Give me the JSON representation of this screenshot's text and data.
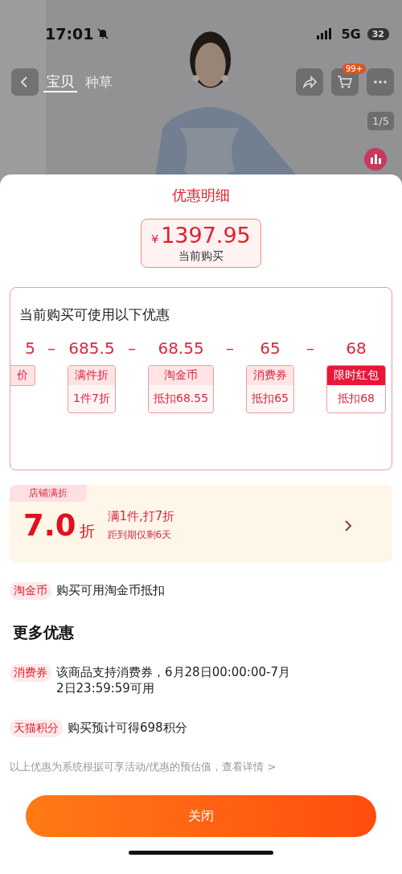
{
  "status_bar": {
    "time": "17:01",
    "network": "5G",
    "battery": "32"
  },
  "nav": {
    "tabs": [
      {
        "label": "宝贝",
        "selected": true
      },
      {
        "label": "种草",
        "selected": false
      }
    ],
    "cart_badge": "99+",
    "page_indicator": "1/5"
  },
  "sheet": {
    "title": "优惠明细",
    "price": {
      "currency": "¥",
      "amount": "1397.95",
      "label": "当前购买"
    },
    "breakdown": {
      "heading": "当前购买可使用以下优惠",
      "items": [
        {
          "amount": "5",
          "tag": "价",
          "kind": "normal"
        },
        {
          "operator": "–",
          "amount": "685.5",
          "tag": "满件折",
          "detail": "1件7折",
          "kind": "normal"
        },
        {
          "operator": "–",
          "amount": "68.55",
          "tag": "淘金币",
          "detail": "抵扣68.55",
          "kind": "normal"
        },
        {
          "operator": "–",
          "amount": "65",
          "tag": "消费券",
          "detail": "抵扣65",
          "kind": "normal"
        },
        {
          "operator": "–",
          "amount": "68",
          "tag": "限时红包",
          "detail": "抵扣68",
          "kind": "highlight"
        }
      ]
    },
    "store_discount": {
      "badge": "店铺满折",
      "value": "7.0",
      "unit": "折",
      "title": "满1件,打7折",
      "subtitle": "距到期仅剩6天"
    },
    "coin_row": {
      "tag": "淘金币",
      "text": "购买可用淘金币抵扣"
    },
    "more_heading": "更多优惠",
    "more": [
      {
        "tag": "消费券",
        "text": "该商品支持消费券，6月28日00:00:00-7月2日23:59:59可用"
      },
      {
        "tag": "天猫积分",
        "text": "购买预计可得698积分"
      }
    ],
    "note": "以上优惠为系统根据可享活动/优惠的预估值，查看详情 >",
    "close_button": "关闭"
  }
}
